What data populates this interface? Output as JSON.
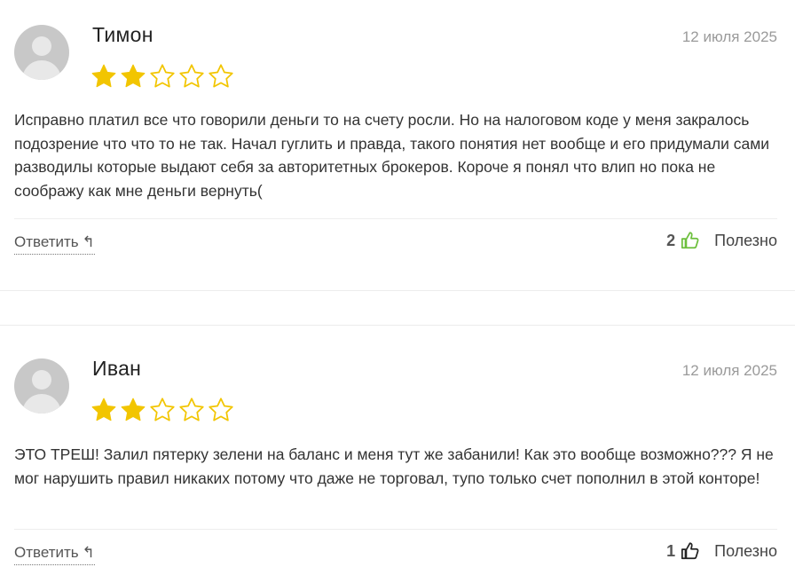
{
  "reviews": [
    {
      "author": "Тимон",
      "date": "12 июля 2025",
      "rating": 2,
      "max_rating": 5,
      "text": "Исправно платил все что говорили деньги то на счету росли. Но на налоговом коде у меня закралось подозрение что что то не так. Начал гуглить и правда, такого понятия нет вообще и его придумали сами разводилы которые выдают себя за авторитетных брокеров. Короче я понял что влип но пока не соображу как мне деньги вернуть(",
      "reply_label": "Ответить",
      "reply_icon": "↰",
      "helpful_count": "2",
      "helpful_label": "Полезно",
      "thumb_color": "#6cbf3c"
    },
    {
      "author": "Иван",
      "date": "12 июля 2025",
      "rating": 2,
      "max_rating": 5,
      "text": "ЭТО ТРЕШ! Залил пятерку зелени на баланс и меня тут же забанили! Как это вообще возможно??? Я не мог нарушить правил никаких потому что даже не торговал, тупо только счет пополнил в этой конторе!",
      "reply_label": "Ответить",
      "reply_icon": "↰",
      "helpful_count": "1",
      "helpful_label": "Полезно",
      "thumb_color": "#222222"
    }
  ],
  "colors": {
    "star_filled": "#f2c500",
    "star_empty_stroke": "#f2c500"
  }
}
